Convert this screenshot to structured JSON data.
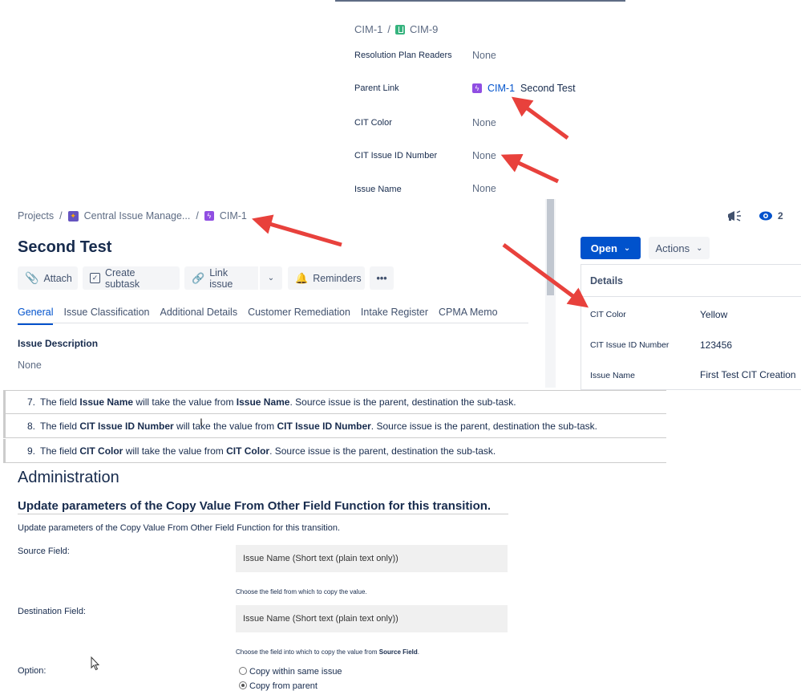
{
  "popup": {
    "breadcrumb": [
      "CIM-1",
      "CIM-9"
    ],
    "fields": [
      {
        "label": "Resolution Plan Readers",
        "value": "None"
      },
      {
        "label": "Parent Link",
        "value_key": "CIM-1",
        "value_title": "Second Test"
      },
      {
        "label": "CIT Color",
        "value": "None"
      },
      {
        "label": "CIT Issue ID Number",
        "value": "None"
      },
      {
        "label": "Issue Name",
        "value": "None"
      }
    ]
  },
  "issue": {
    "breadcrumb": {
      "projects": "Projects",
      "project": "Central Issue Manage...",
      "key": "CIM-1"
    },
    "watchers": "2",
    "title": "Second Test",
    "toolbar": {
      "attach": "Attach",
      "subtask": "Create subtask",
      "link": "Link issue",
      "reminders": "Reminders",
      "more": "•••"
    },
    "tabs": [
      "General",
      "Issue Classification",
      "Additional Details",
      "Customer Remediation",
      "Intake Register",
      "CPMA Memo"
    ],
    "description_label": "Issue Description",
    "description_value": "None",
    "status": "Open",
    "actions": "Actions",
    "details": {
      "heading": "Details",
      "fields": [
        {
          "label": "CIT Color",
          "value": "Yellow"
        },
        {
          "label": "CIT Issue ID Number",
          "value": "123456"
        },
        {
          "label": "Issue Name",
          "value": "First Test CIT Creation"
        }
      ]
    }
  },
  "rules": [
    {
      "num": "7.",
      "pre": "The field ",
      "field": "Issue Name",
      "mid": " will take the value from ",
      "source": "Issue Name",
      "post": ". Source issue is the parent, destination the sub-task."
    },
    {
      "num": "8.",
      "pre": "The field ",
      "field": "CIT Issue ID Number",
      "mid": " will take the value from ",
      "source": "CIT Issue ID Number",
      "post": ". Source issue is the parent, destination the sub-task."
    },
    {
      "num": "9.",
      "pre": "The field ",
      "field": "CIT Color",
      "mid": " will take the value from ",
      "source": "CIT Color",
      "post": ". Source issue is the parent, destination the sub-task."
    }
  ],
  "admin": {
    "heading": "Administration",
    "subheading": "Update parameters of the Copy Value From Other Field Function for this transition.",
    "intro": "Update parameters of the Copy Value From Other Field Function for this transition.",
    "source_label": "Source Field:",
    "source_value": "Issue Name (Short text (plain text only))",
    "source_hint": "Choose the field from which to copy the value.",
    "dest_label": "Destination Field:",
    "dest_value": "Issue Name (Short text (plain text only))",
    "dest_hint_pre": "Choose the field into which to copy the value from ",
    "dest_hint_bold": "Source Field",
    "dest_hint_post": ".",
    "option_label": "Option:",
    "options": [
      {
        "label": "Copy within same issue",
        "selected": false
      },
      {
        "label": "Copy from parent",
        "selected": true
      }
    ]
  },
  "colors": {
    "accent": "#0052cc",
    "arrow": "#e8413c",
    "epic": "#904ee2",
    "story": "#36b37e"
  }
}
